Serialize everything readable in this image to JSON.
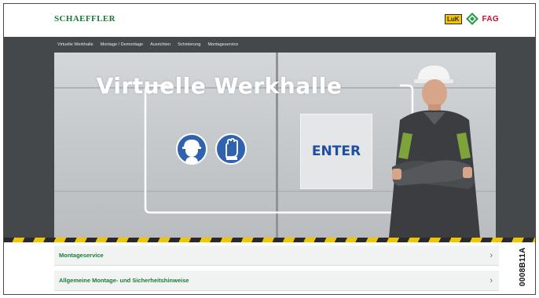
{
  "header": {
    "logo_text": "SCHAEFFLER",
    "brand_luk": "LuK",
    "brand_fag": "FAG",
    "brand_ina_icon": "ina-diamond-icon"
  },
  "nav": {
    "items": [
      "Virtuelle Werkhalle",
      "Montage / Demontage",
      "Ausrichten",
      "Schmierung",
      "Montageservice"
    ]
  },
  "hero": {
    "title": "Virtuelle Werkhalle",
    "enter_label": "ENTER",
    "icons": [
      "safety-helmet-icon",
      "safety-glove-icon"
    ]
  },
  "accordion": {
    "items": [
      {
        "label": "Montageservice",
        "chevron": "›"
      },
      {
        "label": "Allgemeine Montage- und Sicherheitshinweise",
        "chevron": "›"
      }
    ]
  },
  "figure_code": "0008B11A",
  "colors": {
    "brand_green": "#1a7a3a",
    "nav_dark": "#45484b",
    "icon_blue": "#2f63b0",
    "enter_blue": "#1f4fa0",
    "caution_yellow": "#f2c500",
    "fag_red": "#c8102e"
  }
}
